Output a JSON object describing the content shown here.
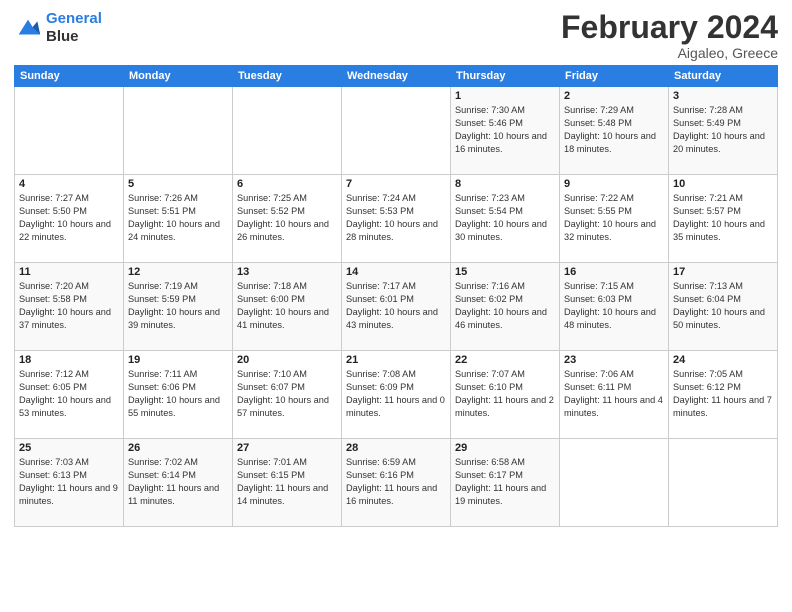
{
  "logo": {
    "line1": "General",
    "line2": "Blue"
  },
  "title": "February 2024",
  "subtitle": "Aigaleo, Greece",
  "days_of_week": [
    "Sunday",
    "Monday",
    "Tuesday",
    "Wednesday",
    "Thursday",
    "Friday",
    "Saturday"
  ],
  "weeks": [
    [
      {
        "num": "",
        "sunrise": "",
        "sunset": "",
        "daylight": ""
      },
      {
        "num": "",
        "sunrise": "",
        "sunset": "",
        "daylight": ""
      },
      {
        "num": "",
        "sunrise": "",
        "sunset": "",
        "daylight": ""
      },
      {
        "num": "",
        "sunrise": "",
        "sunset": "",
        "daylight": ""
      },
      {
        "num": "1",
        "sunrise": "Sunrise: 7:30 AM",
        "sunset": "Sunset: 5:46 PM",
        "daylight": "Daylight: 10 hours and 16 minutes."
      },
      {
        "num": "2",
        "sunrise": "Sunrise: 7:29 AM",
        "sunset": "Sunset: 5:48 PM",
        "daylight": "Daylight: 10 hours and 18 minutes."
      },
      {
        "num": "3",
        "sunrise": "Sunrise: 7:28 AM",
        "sunset": "Sunset: 5:49 PM",
        "daylight": "Daylight: 10 hours and 20 minutes."
      }
    ],
    [
      {
        "num": "4",
        "sunrise": "Sunrise: 7:27 AM",
        "sunset": "Sunset: 5:50 PM",
        "daylight": "Daylight: 10 hours and 22 minutes."
      },
      {
        "num": "5",
        "sunrise": "Sunrise: 7:26 AM",
        "sunset": "Sunset: 5:51 PM",
        "daylight": "Daylight: 10 hours and 24 minutes."
      },
      {
        "num": "6",
        "sunrise": "Sunrise: 7:25 AM",
        "sunset": "Sunset: 5:52 PM",
        "daylight": "Daylight: 10 hours and 26 minutes."
      },
      {
        "num": "7",
        "sunrise": "Sunrise: 7:24 AM",
        "sunset": "Sunset: 5:53 PM",
        "daylight": "Daylight: 10 hours and 28 minutes."
      },
      {
        "num": "8",
        "sunrise": "Sunrise: 7:23 AM",
        "sunset": "Sunset: 5:54 PM",
        "daylight": "Daylight: 10 hours and 30 minutes."
      },
      {
        "num": "9",
        "sunrise": "Sunrise: 7:22 AM",
        "sunset": "Sunset: 5:55 PM",
        "daylight": "Daylight: 10 hours and 32 minutes."
      },
      {
        "num": "10",
        "sunrise": "Sunrise: 7:21 AM",
        "sunset": "Sunset: 5:57 PM",
        "daylight": "Daylight: 10 hours and 35 minutes."
      }
    ],
    [
      {
        "num": "11",
        "sunrise": "Sunrise: 7:20 AM",
        "sunset": "Sunset: 5:58 PM",
        "daylight": "Daylight: 10 hours and 37 minutes."
      },
      {
        "num": "12",
        "sunrise": "Sunrise: 7:19 AM",
        "sunset": "Sunset: 5:59 PM",
        "daylight": "Daylight: 10 hours and 39 minutes."
      },
      {
        "num": "13",
        "sunrise": "Sunrise: 7:18 AM",
        "sunset": "Sunset: 6:00 PM",
        "daylight": "Daylight: 10 hours and 41 minutes."
      },
      {
        "num": "14",
        "sunrise": "Sunrise: 7:17 AM",
        "sunset": "Sunset: 6:01 PM",
        "daylight": "Daylight: 10 hours and 43 minutes."
      },
      {
        "num": "15",
        "sunrise": "Sunrise: 7:16 AM",
        "sunset": "Sunset: 6:02 PM",
        "daylight": "Daylight: 10 hours and 46 minutes."
      },
      {
        "num": "16",
        "sunrise": "Sunrise: 7:15 AM",
        "sunset": "Sunset: 6:03 PM",
        "daylight": "Daylight: 10 hours and 48 minutes."
      },
      {
        "num": "17",
        "sunrise": "Sunrise: 7:13 AM",
        "sunset": "Sunset: 6:04 PM",
        "daylight": "Daylight: 10 hours and 50 minutes."
      }
    ],
    [
      {
        "num": "18",
        "sunrise": "Sunrise: 7:12 AM",
        "sunset": "Sunset: 6:05 PM",
        "daylight": "Daylight: 10 hours and 53 minutes."
      },
      {
        "num": "19",
        "sunrise": "Sunrise: 7:11 AM",
        "sunset": "Sunset: 6:06 PM",
        "daylight": "Daylight: 10 hours and 55 minutes."
      },
      {
        "num": "20",
        "sunrise": "Sunrise: 7:10 AM",
        "sunset": "Sunset: 6:07 PM",
        "daylight": "Daylight: 10 hours and 57 minutes."
      },
      {
        "num": "21",
        "sunrise": "Sunrise: 7:08 AM",
        "sunset": "Sunset: 6:09 PM",
        "daylight": "Daylight: 11 hours and 0 minutes."
      },
      {
        "num": "22",
        "sunrise": "Sunrise: 7:07 AM",
        "sunset": "Sunset: 6:10 PM",
        "daylight": "Daylight: 11 hours and 2 minutes."
      },
      {
        "num": "23",
        "sunrise": "Sunrise: 7:06 AM",
        "sunset": "Sunset: 6:11 PM",
        "daylight": "Daylight: 11 hours and 4 minutes."
      },
      {
        "num": "24",
        "sunrise": "Sunrise: 7:05 AM",
        "sunset": "Sunset: 6:12 PM",
        "daylight": "Daylight: 11 hours and 7 minutes."
      }
    ],
    [
      {
        "num": "25",
        "sunrise": "Sunrise: 7:03 AM",
        "sunset": "Sunset: 6:13 PM",
        "daylight": "Daylight: 11 hours and 9 minutes."
      },
      {
        "num": "26",
        "sunrise": "Sunrise: 7:02 AM",
        "sunset": "Sunset: 6:14 PM",
        "daylight": "Daylight: 11 hours and 11 minutes."
      },
      {
        "num": "27",
        "sunrise": "Sunrise: 7:01 AM",
        "sunset": "Sunset: 6:15 PM",
        "daylight": "Daylight: 11 hours and 14 minutes."
      },
      {
        "num": "28",
        "sunrise": "Sunrise: 6:59 AM",
        "sunset": "Sunset: 6:16 PM",
        "daylight": "Daylight: 11 hours and 16 minutes."
      },
      {
        "num": "29",
        "sunrise": "Sunrise: 6:58 AM",
        "sunset": "Sunset: 6:17 PM",
        "daylight": "Daylight: 11 hours and 19 minutes."
      },
      {
        "num": "",
        "sunrise": "",
        "sunset": "",
        "daylight": ""
      },
      {
        "num": "",
        "sunrise": "",
        "sunset": "",
        "daylight": ""
      }
    ]
  ]
}
